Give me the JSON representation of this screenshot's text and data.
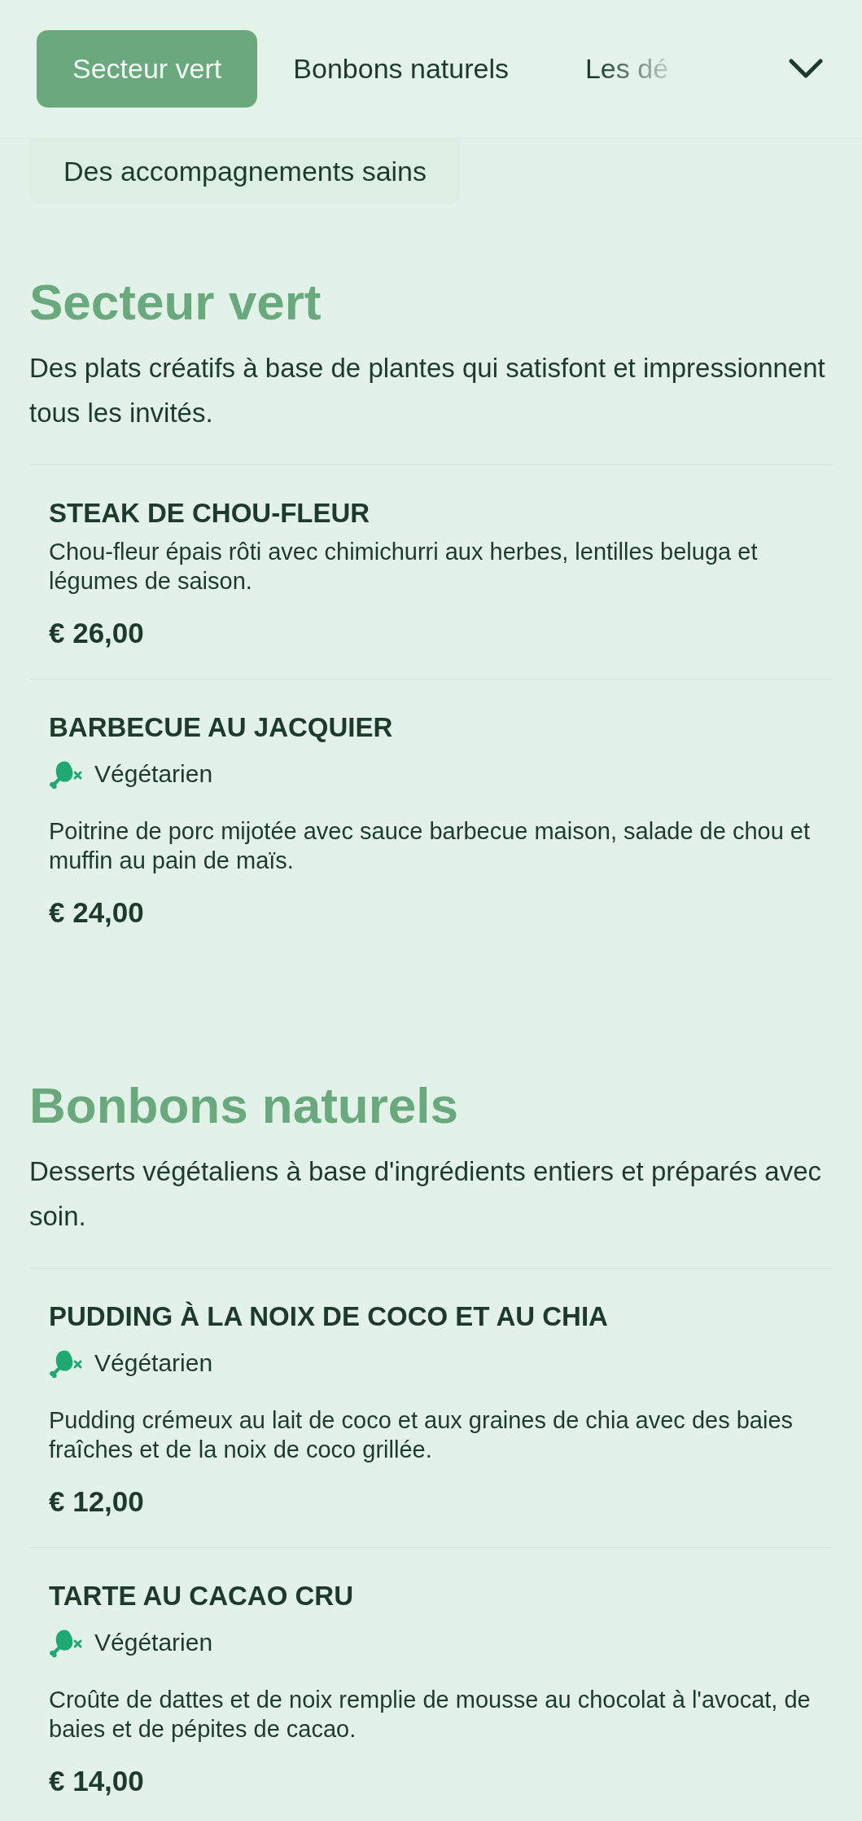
{
  "nav": {
    "tabs": [
      {
        "label": "Secteur vert",
        "selected": true
      },
      {
        "label": "Bonbons naturels",
        "selected": false
      },
      {
        "label": "Les dé",
        "selected": false
      }
    ]
  },
  "sub_tabs": [
    {
      "label": "Des accompagnements sains",
      "selected": false
    }
  ],
  "sections": [
    {
      "title": "Secteur vert",
      "description": "Des plats créatifs à base de plantes qui satisfont et impressionnent tous les invités.",
      "items": [
        {
          "name": "STEAK DE CHOU-FLEUR",
          "description": "Chou-fleur épais rôti avec chimichurri aux herbes, lentilles beluga et légumes de saison.",
          "price": "€ 26,00"
        },
        {
          "name": "BARBECUE AU JACQUIER",
          "tag": "Végétarien",
          "description": "Poitrine de porc mijotée avec sauce barbecue maison, salade de chou et muffin au pain de maïs.",
          "price": "€ 24,00"
        }
      ]
    },
    {
      "title": "Bonbons naturels",
      "description": "Desserts végétaliens à base d'ingrédients entiers et préparés avec soin.",
      "items": [
        {
          "name": "PUDDING À LA NOIX DE COCO ET AU CHIA",
          "tag": "Végétarien",
          "description": "Pudding crémeux au lait de coco et aux graines de chia avec des baies fraîches et de la noix de coco grillée.",
          "price": "€ 12,00"
        },
        {
          "name": "TARTE AU CACAO CRU",
          "tag": "Végétarien",
          "description": "Croûte de dattes et de noix remplie de mousse au chocolat à l'avocat, de baies et de pépites de cacao.",
          "price": "€ 14,00"
        }
      ]
    }
  ]
}
